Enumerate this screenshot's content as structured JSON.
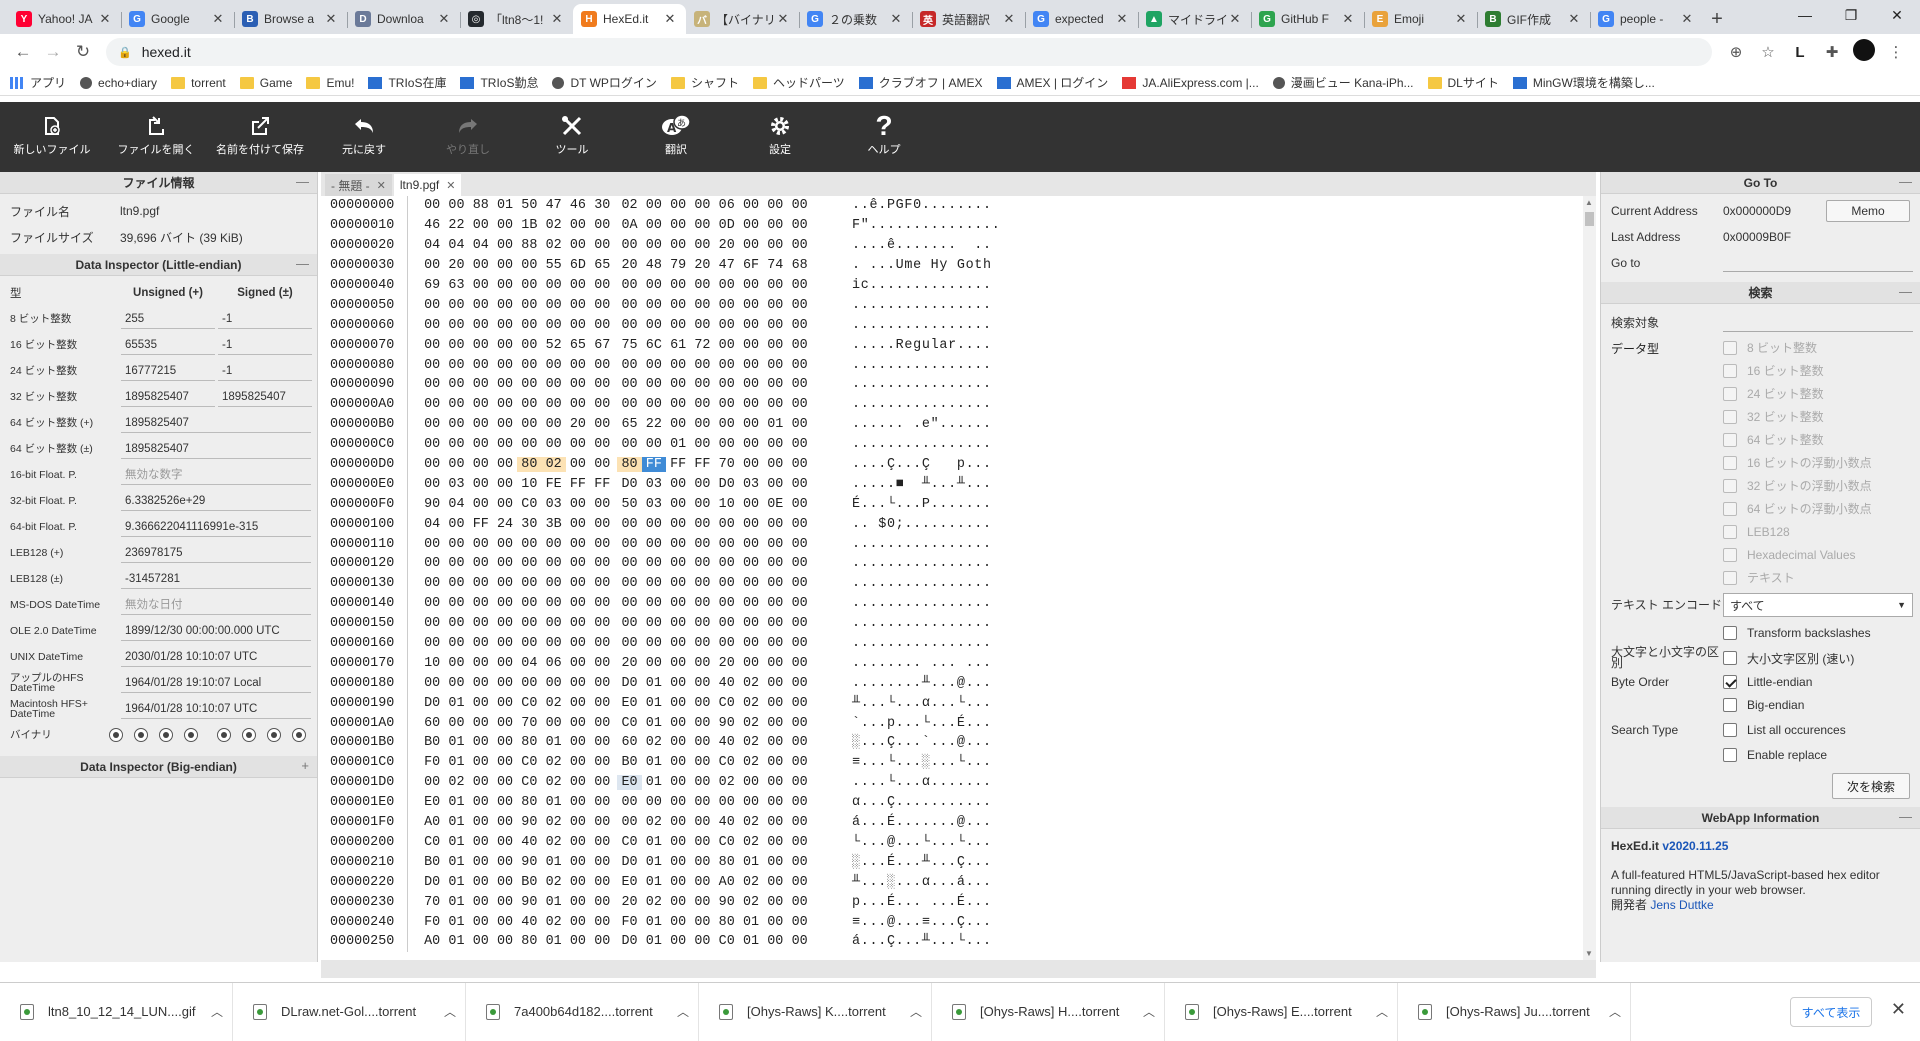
{
  "browser": {
    "tabs": [
      {
        "title": "Yahoo! JA",
        "color": "#ff0033",
        "glyph": "Y"
      },
      {
        "title": "Google",
        "color": "#4285f4",
        "glyph": "G"
      },
      {
        "title": "Browse a",
        "color": "#2b5fb4",
        "glyph": "B"
      },
      {
        "title": "Downloa",
        "color": "#6b7a99",
        "glyph": "D"
      },
      {
        "title": "「ltn8〜1!",
        "color": "#24292e",
        "glyph": "◎"
      },
      {
        "title": "HexEd.it",
        "color": "#f07b1d",
        "glyph": "H"
      },
      {
        "title": "【バイナリ",
        "color": "#c7b37a",
        "glyph": "バ"
      },
      {
        "title": "２の乗数",
        "color": "#4285f4",
        "glyph": "G"
      },
      {
        "title": "英語翻訳",
        "color": "#c62828",
        "glyph": "英"
      },
      {
        "title": "expected",
        "color": "#4285f4",
        "glyph": "G"
      },
      {
        "title": "マイドライブ",
        "color": "#1fa463",
        "glyph": "▲"
      },
      {
        "title": "GitHub F",
        "color": "#2ea44f",
        "glyph": "G"
      },
      {
        "title": "Emoji",
        "color": "#e9a23b",
        "glyph": "E"
      },
      {
        "title": "GIF作成",
        "color": "#2e7d32",
        "glyph": "B"
      },
      {
        "title": "people -",
        "color": "#4285f4",
        "glyph": "G"
      }
    ],
    "url": "hexed.it",
    "bookmarks": [
      {
        "label": "アプリ",
        "type": "grid"
      },
      {
        "label": "echo+diary",
        "type": "circle"
      },
      {
        "label": "torrent",
        "type": "folder"
      },
      {
        "label": "Game",
        "type": "folder"
      },
      {
        "label": "Emu!",
        "type": "folder"
      },
      {
        "label": "TRIoS在庫",
        "type": "sq"
      },
      {
        "label": "TRIoS勤怠",
        "type": "sq"
      },
      {
        "label": "DT WPログイン",
        "type": "circle"
      },
      {
        "label": "シャフト",
        "type": "folder"
      },
      {
        "label": "ヘッドパーツ",
        "type": "folder"
      },
      {
        "label": "クラブオフ | AMEX",
        "type": "sq"
      },
      {
        "label": "AMEX | ログイン",
        "type": "sq"
      },
      {
        "label": "JA.AliExpress.com |...",
        "type": "red"
      },
      {
        "label": "漫画ビュー Kana-iPh...",
        "type": "circle"
      },
      {
        "label": "DLサイト",
        "type": "folder"
      },
      {
        "label": "MinGW環境を構築し...",
        "type": "sq"
      }
    ]
  },
  "toolbar": {
    "new_file": "新しいファイル",
    "open_file": "ファイルを開く",
    "save_as": "名前を付けて保存",
    "undo": "元に戻す",
    "redo": "やり直し",
    "tools": "ツール",
    "translate": "翻訳",
    "settings": "設定",
    "help": "ヘルプ"
  },
  "file_info": {
    "header": "ファイル情報",
    "name_label": "ファイル名",
    "name_value": "ltn9.pgf",
    "size_label": "ファイルサイズ",
    "size_value": "39,696 バイト (39 KiB)"
  },
  "inspector_le": {
    "header": "Data Inspector (Little-endian)",
    "col_type": "型",
    "col_unsigned": "Unsigned (+)",
    "col_signed": "Signed (±)",
    "rows": [
      {
        "type": "8 ビット整数",
        "unsigned": "255",
        "signed": "-1"
      },
      {
        "type": "16 ビット整数",
        "unsigned": "65535",
        "signed": "-1"
      },
      {
        "type": "24 ビット整数",
        "unsigned": "16777215",
        "signed": "-1"
      },
      {
        "type": "32 ビット整数",
        "unsigned": "1895825407",
        "signed": "1895825407"
      },
      {
        "type": "64 ビット整数 (+)",
        "value": "1895825407"
      },
      {
        "type": "64 ビット整数 (±)",
        "value": "1895825407"
      },
      {
        "type": "16-bit Float. P.",
        "value": "無効な数字",
        "gray": true
      },
      {
        "type": "32-bit Float. P.",
        "value": "6.3382526e+29"
      },
      {
        "type": "64-bit Float. P.",
        "value": "9.366622041116991e-315"
      },
      {
        "type": "LEB128 (+)",
        "value": "236978175"
      },
      {
        "type": "LEB128 (±)",
        "value": "-31457281"
      },
      {
        "type": "MS-DOS DateTime",
        "value": "無効な日付",
        "gray": true
      },
      {
        "type": "OLE 2.0 DateTime",
        "value": "1899/12/30 00:00:00.000 UTC"
      },
      {
        "type": "UNIX DateTime",
        "value": "2030/01/28 10:10:07 UTC"
      },
      {
        "type": "アップルのHFS DateTime",
        "value": "1964/01/28 19:10:07 Local"
      },
      {
        "type": "Macintosh HFS+ DateTime",
        "value": "1964/01/28 10:10:07 UTC"
      }
    ],
    "binary_label": "バイナリ"
  },
  "inspector_be": {
    "header": "Data Inspector (Big-endian)"
  },
  "file_tabs": [
    {
      "label": "- 無題 -",
      "active": false
    },
    {
      "label": "ltn9.pgf",
      "active": true
    }
  ],
  "hex": [
    {
      "addr": "00000000",
      "bytes": [
        "00",
        "00",
        "88",
        "01",
        "50",
        "47",
        "46",
        "30",
        "02",
        "00",
        "00",
        "00",
        "06",
        "00",
        "00",
        "00"
      ],
      "ascii": "..ê.PGF0........"
    },
    {
      "addr": "00000010",
      "bytes": [
        "46",
        "22",
        "00",
        "00",
        "1B",
        "02",
        "00",
        "00",
        "0A",
        "00",
        "00",
        "00",
        "0D",
        "00",
        "00",
        "00"
      ],
      "ascii": "F\"..............."
    },
    {
      "addr": "00000020",
      "bytes": [
        "04",
        "04",
        "04",
        "00",
        "88",
        "02",
        "00",
        "00",
        "00",
        "00",
        "00",
        "00",
        "20",
        "00",
        "00",
        "00"
      ],
      "ascii": "....ê.......  .."
    },
    {
      "addr": "00000030",
      "bytes": [
        "00",
        "20",
        "00",
        "00",
        "00",
        "55",
        "6D",
        "65",
        "20",
        "48",
        "79",
        "20",
        "47",
        "6F",
        "74",
        "68"
      ],
      "ascii": ". ...Ume Hy Goth"
    },
    {
      "addr": "00000040",
      "bytes": [
        "69",
        "63",
        "00",
        "00",
        "00",
        "00",
        "00",
        "00",
        "00",
        "00",
        "00",
        "00",
        "00",
        "00",
        "00",
        "00"
      ],
      "ascii": "ic.............."
    },
    {
      "addr": "00000050",
      "bytes": [
        "00",
        "00",
        "00",
        "00",
        "00",
        "00",
        "00",
        "00",
        "00",
        "00",
        "00",
        "00",
        "00",
        "00",
        "00",
        "00"
      ],
      "ascii": "................"
    },
    {
      "addr": "00000060",
      "bytes": [
        "00",
        "00",
        "00",
        "00",
        "00",
        "00",
        "00",
        "00",
        "00",
        "00",
        "00",
        "00",
        "00",
        "00",
        "00",
        "00"
      ],
      "ascii": "................"
    },
    {
      "addr": "00000070",
      "bytes": [
        "00",
        "00",
        "00",
        "00",
        "00",
        "52",
        "65",
        "67",
        "75",
        "6C",
        "61",
        "72",
        "00",
        "00",
        "00",
        "00"
      ],
      "ascii": ".....Regular...."
    },
    {
      "addr": "00000080",
      "bytes": [
        "00",
        "00",
        "00",
        "00",
        "00",
        "00",
        "00",
        "00",
        "00",
        "00",
        "00",
        "00",
        "00",
        "00",
        "00",
        "00"
      ],
      "ascii": "................"
    },
    {
      "addr": "00000090",
      "bytes": [
        "00",
        "00",
        "00",
        "00",
        "00",
        "00",
        "00",
        "00",
        "00",
        "00",
        "00",
        "00",
        "00",
        "00",
        "00",
        "00"
      ],
      "ascii": "................"
    },
    {
      "addr": "000000A0",
      "bytes": [
        "00",
        "00",
        "00",
        "00",
        "00",
        "00",
        "00",
        "00",
        "00",
        "00",
        "00",
        "00",
        "00",
        "00",
        "00",
        "00"
      ],
      "ascii": "................"
    },
    {
      "addr": "000000B0",
      "bytes": [
        "00",
        "00",
        "00",
        "00",
        "00",
        "00",
        "20",
        "00",
        "65",
        "22",
        "00",
        "00",
        "00",
        "00",
        "01",
        "00"
      ],
      "ascii": "...... .e\"......"
    },
    {
      "addr": "000000C0",
      "bytes": [
        "00",
        "00",
        "00",
        "00",
        "00",
        "00",
        "00",
        "00",
        "00",
        "00",
        "01",
        "00",
        "00",
        "00",
        "00",
        "00"
      ],
      "ascii": "................"
    },
    {
      "addr": "000000D0",
      "bytes": [
        "00",
        "00",
        "00",
        "00",
        "80",
        "02",
        "00",
        "00",
        "80",
        "FF",
        "FF",
        "FF",
        "70",
        "00",
        "00",
        "00"
      ],
      "ascii": "....Ç...Ç   p..."
    },
    {
      "addr": "000000E0",
      "bytes": [
        "00",
        "03",
        "00",
        "00",
        "10",
        "FE",
        "FF",
        "FF",
        "D0",
        "03",
        "00",
        "00",
        "D0",
        "03",
        "00",
        "00"
      ],
      "ascii": ".....■  ╨...╨..."
    },
    {
      "addr": "000000F0",
      "bytes": [
        "90",
        "04",
        "00",
        "00",
        "C0",
        "03",
        "00",
        "00",
        "50",
        "03",
        "00",
        "00",
        "10",
        "00",
        "0E",
        "00"
      ],
      "ascii": "É...└...P......."
    },
    {
      "addr": "00000100",
      "bytes": [
        "04",
        "00",
        "FF",
        "24",
        "30",
        "3B",
        "00",
        "00",
        "00",
        "00",
        "00",
        "00",
        "00",
        "00",
        "00",
        "00"
      ],
      "ascii": ".. $0;.........."
    },
    {
      "addr": "00000110",
      "bytes": [
        "00",
        "00",
        "00",
        "00",
        "00",
        "00",
        "00",
        "00",
        "00",
        "00",
        "00",
        "00",
        "00",
        "00",
        "00",
        "00"
      ],
      "ascii": "................"
    },
    {
      "addr": "00000120",
      "bytes": [
        "00",
        "00",
        "00",
        "00",
        "00",
        "00",
        "00",
        "00",
        "00",
        "00",
        "00",
        "00",
        "00",
        "00",
        "00",
        "00"
      ],
      "ascii": "................"
    },
    {
      "addr": "00000130",
      "bytes": [
        "00",
        "00",
        "00",
        "00",
        "00",
        "00",
        "00",
        "00",
        "00",
        "00",
        "00",
        "00",
        "00",
        "00",
        "00",
        "00"
      ],
      "ascii": "................"
    },
    {
      "addr": "00000140",
      "bytes": [
        "00",
        "00",
        "00",
        "00",
        "00",
        "00",
        "00",
        "00",
        "00",
        "00",
        "00",
        "00",
        "00",
        "00",
        "00",
        "00"
      ],
      "ascii": "................"
    },
    {
      "addr": "00000150",
      "bytes": [
        "00",
        "00",
        "00",
        "00",
        "00",
        "00",
        "00",
        "00",
        "00",
        "00",
        "00",
        "00",
        "00",
        "00",
        "00",
        "00"
      ],
      "ascii": "................"
    },
    {
      "addr": "00000160",
      "bytes": [
        "00",
        "00",
        "00",
        "00",
        "00",
        "00",
        "00",
        "00",
        "00",
        "00",
        "00",
        "00",
        "00",
        "00",
        "00",
        "00"
      ],
      "ascii": "................"
    },
    {
      "addr": "00000170",
      "bytes": [
        "10",
        "00",
        "00",
        "00",
        "04",
        "06",
        "00",
        "00",
        "20",
        "00",
        "00",
        "00",
        "20",
        "00",
        "00",
        "00"
      ],
      "ascii": "........ ... ..."
    },
    {
      "addr": "00000180",
      "bytes": [
        "00",
        "00",
        "00",
        "00",
        "00",
        "00",
        "00",
        "00",
        "D0",
        "01",
        "00",
        "00",
        "40",
        "02",
        "00",
        "00"
      ],
      "ascii": "........╨...@..."
    },
    {
      "addr": "00000190",
      "bytes": [
        "D0",
        "01",
        "00",
        "00",
        "C0",
        "02",
        "00",
        "00",
        "E0",
        "01",
        "00",
        "00",
        "C0",
        "02",
        "00",
        "00"
      ],
      "ascii": "╨...└...α...└..."
    },
    {
      "addr": "000001A0",
      "bytes": [
        "60",
        "00",
        "00",
        "00",
        "70",
        "00",
        "00",
        "00",
        "C0",
        "01",
        "00",
        "00",
        "90",
        "02",
        "00",
        "00"
      ],
      "ascii": "`...p...└...É..."
    },
    {
      "addr": "000001B0",
      "bytes": [
        "B0",
        "01",
        "00",
        "00",
        "80",
        "01",
        "00",
        "00",
        "60",
        "02",
        "00",
        "00",
        "40",
        "02",
        "00",
        "00"
      ],
      "ascii": "░...Ç...`...@..."
    },
    {
      "addr": "000001C0",
      "bytes": [
        "F0",
        "01",
        "00",
        "00",
        "C0",
        "02",
        "00",
        "00",
        "B0",
        "01",
        "00",
        "00",
        "C0",
        "02",
        "00",
        "00"
      ],
      "ascii": "≡...└...░...└..."
    },
    {
      "addr": "000001D0",
      "bytes": [
        "00",
        "02",
        "00",
        "00",
        "C0",
        "02",
        "00",
        "00",
        "E0",
        "01",
        "00",
        "00",
        "02",
        "00",
        "00",
        "00"
      ],
      "ascii": "....└...α......."
    },
    {
      "addr": "000001E0",
      "bytes": [
        "E0",
        "01",
        "00",
        "00",
        "80",
        "01",
        "00",
        "00",
        "00",
        "00",
        "00",
        "00",
        "00",
        "00",
        "00",
        "00"
      ],
      "ascii": "α...Ç..........."
    },
    {
      "addr": "000001F0",
      "bytes": [
        "A0",
        "01",
        "00",
        "00",
        "90",
        "02",
        "00",
        "00",
        "00",
        "02",
        "00",
        "00",
        "40",
        "02",
        "00",
        "00"
      ],
      "ascii": "á...É.......@..."
    },
    {
      "addr": "00000200",
      "bytes": [
        "C0",
        "01",
        "00",
        "00",
        "40",
        "02",
        "00",
        "00",
        "C0",
        "01",
        "00",
        "00",
        "C0",
        "02",
        "00",
        "00"
      ],
      "ascii": "└...@...└...└..."
    },
    {
      "addr": "00000210",
      "bytes": [
        "B0",
        "01",
        "00",
        "00",
        "90",
        "01",
        "00",
        "00",
        "D0",
        "01",
        "00",
        "00",
        "80",
        "01",
        "00",
        "00"
      ],
      "ascii": "░...É...╨...Ç..."
    },
    {
      "addr": "00000220",
      "bytes": [
        "D0",
        "01",
        "00",
        "00",
        "B0",
        "02",
        "00",
        "00",
        "E0",
        "01",
        "00",
        "00",
        "A0",
        "02",
        "00",
        "00"
      ],
      "ascii": "╨...░...α...á..."
    },
    {
      "addr": "00000230",
      "bytes": [
        "70",
        "01",
        "00",
        "00",
        "90",
        "01",
        "00",
        "00",
        "20",
        "02",
        "00",
        "00",
        "90",
        "02",
        "00",
        "00"
      ],
      "ascii": "p...É... ...É..."
    },
    {
      "addr": "00000240",
      "bytes": [
        "F0",
        "01",
        "00",
        "00",
        "40",
        "02",
        "00",
        "00",
        "F0",
        "01",
        "00",
        "00",
        "80",
        "01",
        "00",
        "00"
      ],
      "ascii": "≡...@...≡...Ç..."
    },
    {
      "addr": "00000250",
      "bytes": [
        "A0",
        "01",
        "00",
        "00",
        "80",
        "01",
        "00",
        "00",
        "D0",
        "01",
        "00",
        "00",
        "C0",
        "01",
        "00",
        "00"
      ],
      "ascii": "á...Ç...╨...└..."
    }
  ],
  "goto": {
    "header": "Go To",
    "current_label": "Current Address",
    "current_value": "0x000000D9",
    "memo": "Memo",
    "last_label": "Last Address",
    "last_value": "0x00009B0F",
    "goto_label": "Go to"
  },
  "search": {
    "header": "検索",
    "target_label": "検索対象",
    "datatype_label": "データ型",
    "datatypes": [
      "8 ビット整数",
      "16 ビット整数",
      "24 ビット整数",
      "32 ビット整数",
      "64 ビット整数",
      "16 ビットの浮動小数点",
      "32 ビットの浮動小数点",
      "64 ビットの浮動小数点",
      "LEB128",
      "Hexadecimal Values",
      "テキスト"
    ],
    "encoding_label": "テキスト エンコード",
    "encoding_value": "すべて",
    "transform_backslashes": "Transform backslashes",
    "case_label": "大文字と小文字の区別",
    "case_option": "大小文字区別 (速い)",
    "byteorder_label": "Byte Order",
    "little_endian": "Little-endian",
    "big_endian": "Big-endian",
    "searchtype_label": "Search Type",
    "list_all": "List all occurences",
    "enable_replace": "Enable replace",
    "find_next": "次を検索"
  },
  "webapp": {
    "header": "WebApp Information",
    "name": "HexEd.it",
    "version": "v2020.11.25",
    "desc": "A full-featured HTML5/JavaScript-based hex editor running directly in your web browser.",
    "dev_label": "開発者",
    "dev_name": "Jens Duttke"
  },
  "downloads": [
    "ltn8_10_12_14_LUN....gif",
    "DLraw.net-Gol....torrent",
    "7a400b64d182....torrent",
    "[Ohys-Raws] K....torrent",
    "[Ohys-Raws] H....torrent",
    "[Ohys-Raws] E....torrent",
    "[Ohys-Raws] Ju....torrent"
  ],
  "show_all": "すべて表示",
  "highlights": {
    "warm": [
      "D0:4",
      "D0:5",
      "D0:8"
    ],
    "selected": [
      "D0:9"
    ],
    "caret": [
      "1D0:8"
    ]
  }
}
